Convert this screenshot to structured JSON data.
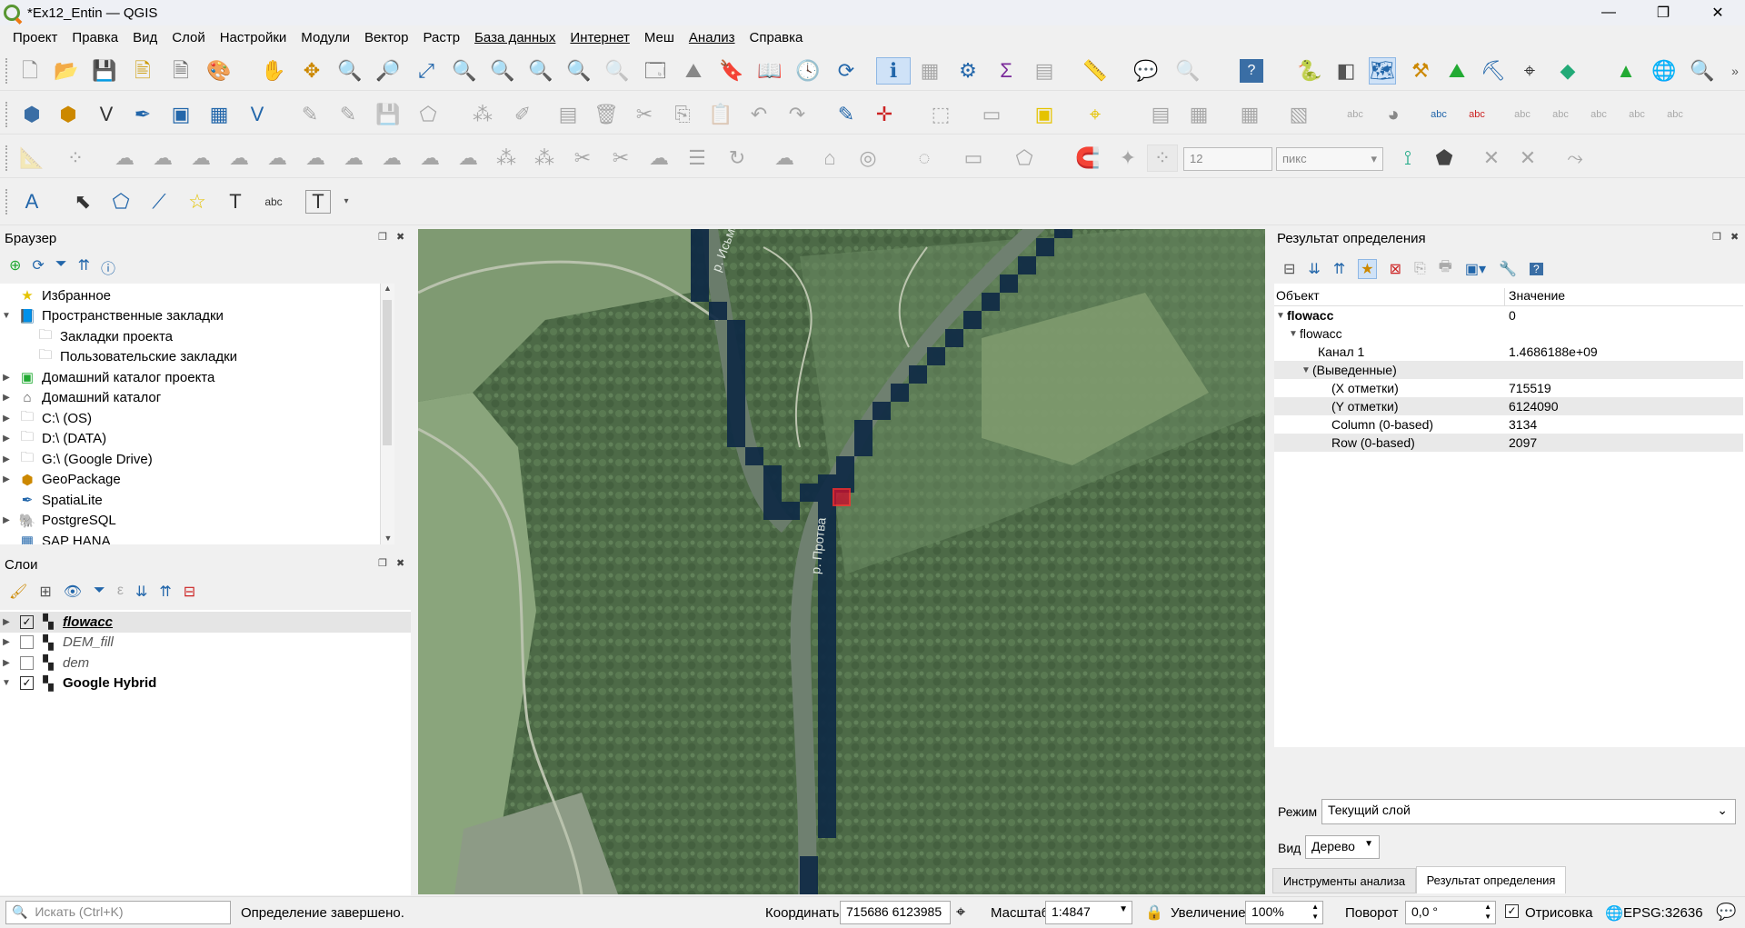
{
  "window": {
    "title": "*Ex12_Entin — QGIS",
    "minimize": "—",
    "restore": "❐",
    "close": "✕"
  },
  "menu": [
    "Проект",
    "Правка",
    "Вид",
    "Слой",
    "Настройки",
    "Модули",
    "Вектор",
    "Растр",
    "База данных",
    "Интернет",
    "Меш",
    "Анализ",
    "Справка"
  ],
  "toolbar": {
    "snap_tolerance": "12",
    "snap_units": "пикс"
  },
  "browser": {
    "title": "Браузер",
    "items": [
      {
        "label": "Избранное",
        "icon": "star-icon"
      },
      {
        "label": "Пространственные закладки",
        "icon": "bookmark-icon"
      },
      {
        "label": "Закладки проекта",
        "icon": "folder-icon"
      },
      {
        "label": "Пользовательские закладки",
        "icon": "folder-icon"
      },
      {
        "label": "Домашний каталог проекта",
        "icon": "project-home-icon"
      },
      {
        "label": "Домашний каталог",
        "icon": "home-icon"
      },
      {
        "label": "C:\\ (OS)",
        "icon": "folder-icon"
      },
      {
        "label": "D:\\ (DATA)",
        "icon": "folder-icon"
      },
      {
        "label": "G:\\ (Google Drive)",
        "icon": "folder-icon"
      },
      {
        "label": "GeoPackage",
        "icon": "geopackage-icon"
      },
      {
        "label": "SpatiaLite",
        "icon": "spatialite-icon"
      },
      {
        "label": "PostgreSQL",
        "icon": "postgresql-icon"
      },
      {
        "label": "SAP HANA",
        "icon": "hana-icon"
      }
    ]
  },
  "layers": {
    "title": "Слои",
    "items": [
      {
        "label": "flowacc",
        "checked": true
      },
      {
        "label": "DEM_fill",
        "checked": false
      },
      {
        "label": "dem",
        "checked": false
      },
      {
        "label": "Google Hybrid",
        "checked": true
      }
    ]
  },
  "map": {
    "label_1": "р. Исьма",
    "label_2": "р. Протва"
  },
  "identify": {
    "title": "Результат определения",
    "col_feature": "Объект",
    "col_value": "Значение",
    "rows": [
      {
        "label": "flowacc",
        "value": "0"
      },
      {
        "label": "flowacc",
        "value": ""
      },
      {
        "label": "Канал 1",
        "value": "1.4686188e+09"
      },
      {
        "label": "(Выведенные)",
        "value": ""
      },
      {
        "label": "(X отметки)",
        "value": "715519"
      },
      {
        "label": "(Y отметки)",
        "value": "6124090"
      },
      {
        "label": "Column (0-based)",
        "value": "3134"
      },
      {
        "label": "Row (0-based)",
        "value": "2097"
      }
    ],
    "mode_label": "Режим",
    "mode_value": "Текущий слой",
    "view_label": "Вид",
    "view_value": "Дерево",
    "tab_processing": "Инструменты анализа",
    "tab_identify": "Результат определения"
  },
  "status": {
    "search_placeholder": "Искать (Ctrl+K)",
    "message": "Определение завершено.",
    "coord_label": "Координаты",
    "coord_value": "715686  6123985",
    "scale_label": "Масштаб",
    "scale_value": "1:4847",
    "magnifier_label": "Увеличение",
    "magnifier_value": "100%",
    "rotation_label": "Поворот",
    "rotation_value": "0,0 °",
    "render_label": "Отрисовка",
    "crs": "EPSG:32636"
  }
}
